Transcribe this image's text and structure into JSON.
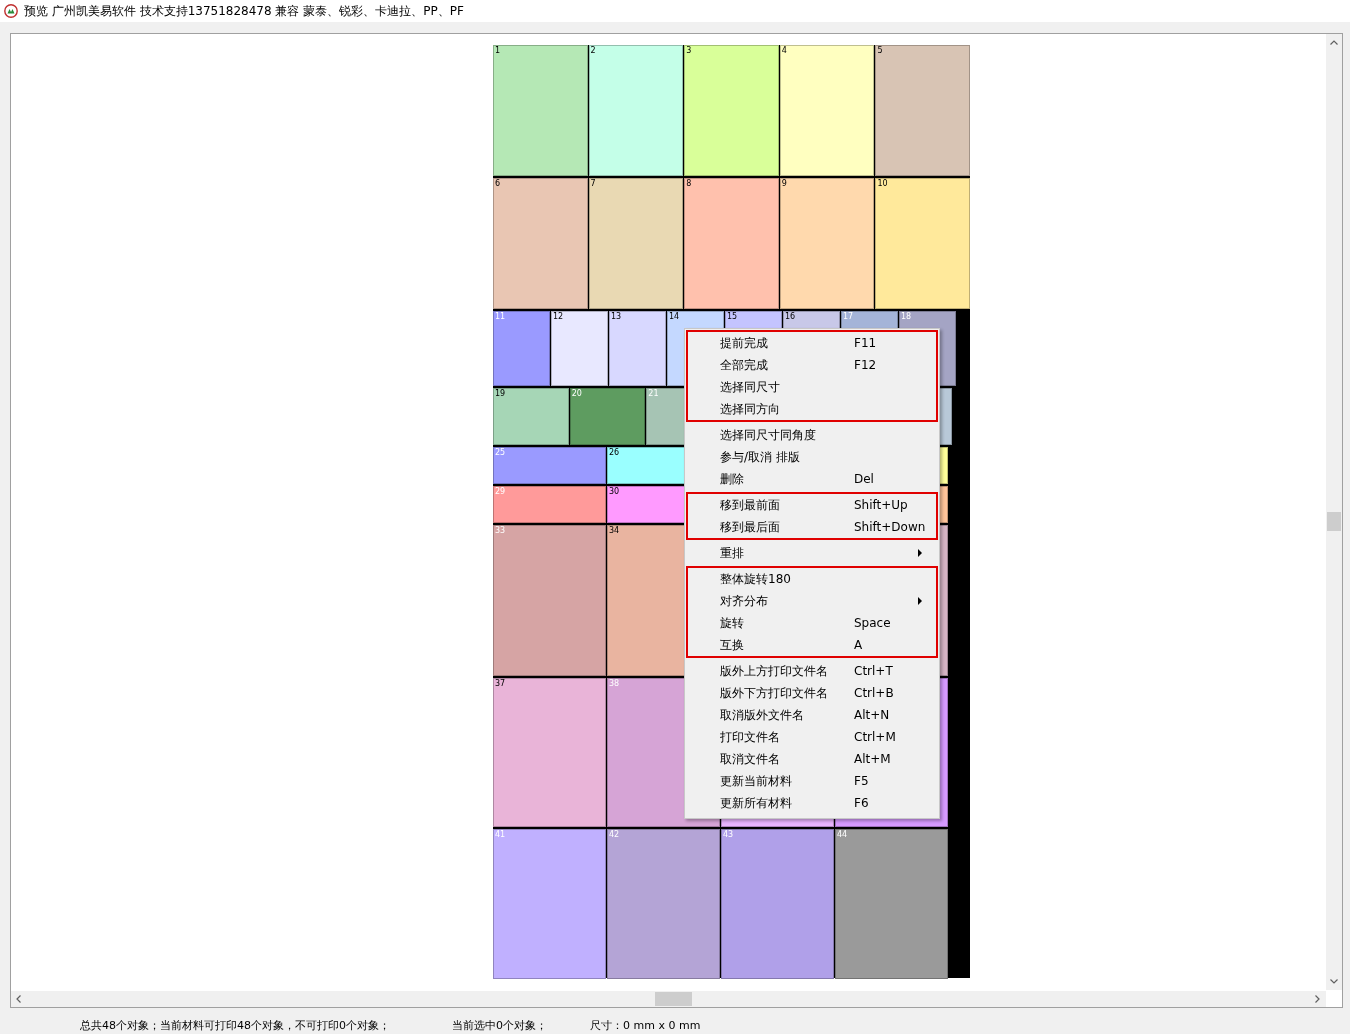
{
  "window": {
    "title": "预览 广州凯美易软件 技术支持13751828478 兼容 蒙泰、锐彩、卡迪拉、PP、PF"
  },
  "sheet": {
    "rows": [
      {
        "tiles": [
          {
            "number": "1",
            "color": "#b5e8b5",
            "light_number": false
          },
          {
            "number": "2",
            "color": "#c4ffe8",
            "light_number": false
          },
          {
            "number": "3",
            "color": "#d9ff99",
            "light_number": false
          },
          {
            "number": "4",
            "color": "#ffffc0",
            "light_number": false
          },
          {
            "number": "5",
            "color": "#d8c4b4",
            "light_number": false
          }
        ]
      },
      {
        "tiles": [
          {
            "number": "6",
            "color": "#e9c6b3",
            "light_number": false
          },
          {
            "number": "7",
            "color": "#e9d9b3",
            "light_number": false
          },
          {
            "number": "8",
            "color": "#ffc1ad",
            "light_number": false
          },
          {
            "number": "9",
            "color": "#ffd9ad",
            "light_number": false
          },
          {
            "number": "10",
            "color": "#ffe99b",
            "light_number": false
          }
        ]
      },
      {
        "tiles": [
          {
            "number": "11",
            "color": "#9a9aff",
            "light_number": true
          },
          {
            "number": "12",
            "color": "#e8e8ff",
            "light_number": false
          },
          {
            "number": "13",
            "color": "#d8d8ff",
            "light_number": false
          },
          {
            "number": "14",
            "color": "#c4d8ff",
            "light_number": false
          },
          {
            "number": "15",
            "color": "#c4c4ff",
            "light_number": false
          },
          {
            "number": "16",
            "color": "#c8c8e8",
            "light_number": false
          },
          {
            "number": "17",
            "color": "#a4b4d8",
            "light_number": true
          },
          {
            "number": "18",
            "color": "#a4a4c4",
            "light_number": true
          }
        ]
      },
      {
        "tiles": [
          {
            "number": "19",
            "color": "#a6d6b6",
            "light_number": false
          },
          {
            "number": "20",
            "color": "#5e9c60",
            "light_number": true
          },
          {
            "number": "21",
            "color": "#a6c4b4",
            "light_number": true
          },
          {
            "color": "#b8c8d8"
          }
        ]
      },
      {
        "tiles": [
          {
            "number": "25",
            "color": "#9a9aff",
            "light_number": true
          },
          {
            "number": "26",
            "color": "#9affff",
            "light_number": false
          },
          {
            "color": "#ffff9a"
          }
        ]
      },
      {
        "tiles": [
          {
            "number": "29",
            "color": "#ff9a9a",
            "light_number": true
          },
          {
            "number": "30",
            "color": "#ff9aff",
            "light_number": false
          },
          {
            "color": "#ffc49a"
          }
        ]
      },
      {
        "tiles": [
          {
            "number": "33",
            "color": "#d6a4a4",
            "light_number": true
          },
          {
            "number": "34",
            "color": "#e9b4a0",
            "light_number": false
          },
          {
            "color": "#d6b4c4"
          }
        ]
      },
      {
        "tiles": [
          {
            "number": "37",
            "color": "#e9b4d8",
            "light_number": false
          },
          {
            "number": "38",
            "color": "#d6a4d6",
            "light_number": true
          },
          {
            "color": "#e9b4ff"
          },
          {
            "color": "#d69aff"
          }
        ]
      },
      {
        "tiles": [
          {
            "number": "41",
            "color": "#c0b0ff",
            "light_number": true
          },
          {
            "number": "42",
            "color": "#b4a4d6",
            "light_number": true
          },
          {
            "number": "43",
            "color": "#b0a0e9",
            "light_number": true
          },
          {
            "number": "44",
            "color": "#9a9a9a",
            "light_number": true
          }
        ]
      }
    ]
  },
  "context_menu": {
    "groups": [
      {
        "highlighted": true,
        "items": [
          {
            "label": "提前完成",
            "shortcut": "F11"
          },
          {
            "label": "全部完成",
            "shortcut": "F12"
          },
          {
            "label": "选择同尺寸"
          },
          {
            "label": "选择同方向"
          }
        ]
      },
      {
        "highlighted": false,
        "items": [
          {
            "label": "选择同尺寸同角度"
          },
          {
            "label": "参与/取消 排版"
          },
          {
            "label": "删除",
            "shortcut": "Del"
          }
        ]
      },
      {
        "highlighted": true,
        "items": [
          {
            "label": "移到最前面",
            "shortcut": "Shift+Up"
          },
          {
            "label": "移到最后面",
            "shortcut": "Shift+Down"
          }
        ]
      },
      {
        "highlighted": false,
        "items": [
          {
            "label": "重排",
            "submenu": true
          }
        ]
      },
      {
        "highlighted": true,
        "items": [
          {
            "label": "整体旋转180"
          },
          {
            "label": "对齐分布",
            "submenu": true
          },
          {
            "label": "旋转",
            "shortcut": "Space"
          },
          {
            "label": "互换",
            "shortcut": "A"
          }
        ]
      },
      {
        "highlighted": false,
        "items": [
          {
            "label": "版外上方打印文件名",
            "shortcut": "Ctrl+T"
          },
          {
            "label": "版外下方打印文件名",
            "shortcut": "Ctrl+B"
          },
          {
            "label": "取消版外文件名",
            "shortcut": "Alt+N"
          },
          {
            "label": "打印文件名",
            "shortcut": "Ctrl+M"
          },
          {
            "label": "取消文件名",
            "shortcut": "Alt+M"
          },
          {
            "label": "更新当前材料",
            "shortcut": "F5"
          },
          {
            "label": "更新所有材料",
            "shortcut": "F6"
          }
        ]
      }
    ]
  },
  "status_bar": [
    "总共48个对象；当前材料可打印48个对象，不可打印0个对象；",
    "当前选中0个对象；",
    "尺寸：0 mm x 0 mm"
  ]
}
